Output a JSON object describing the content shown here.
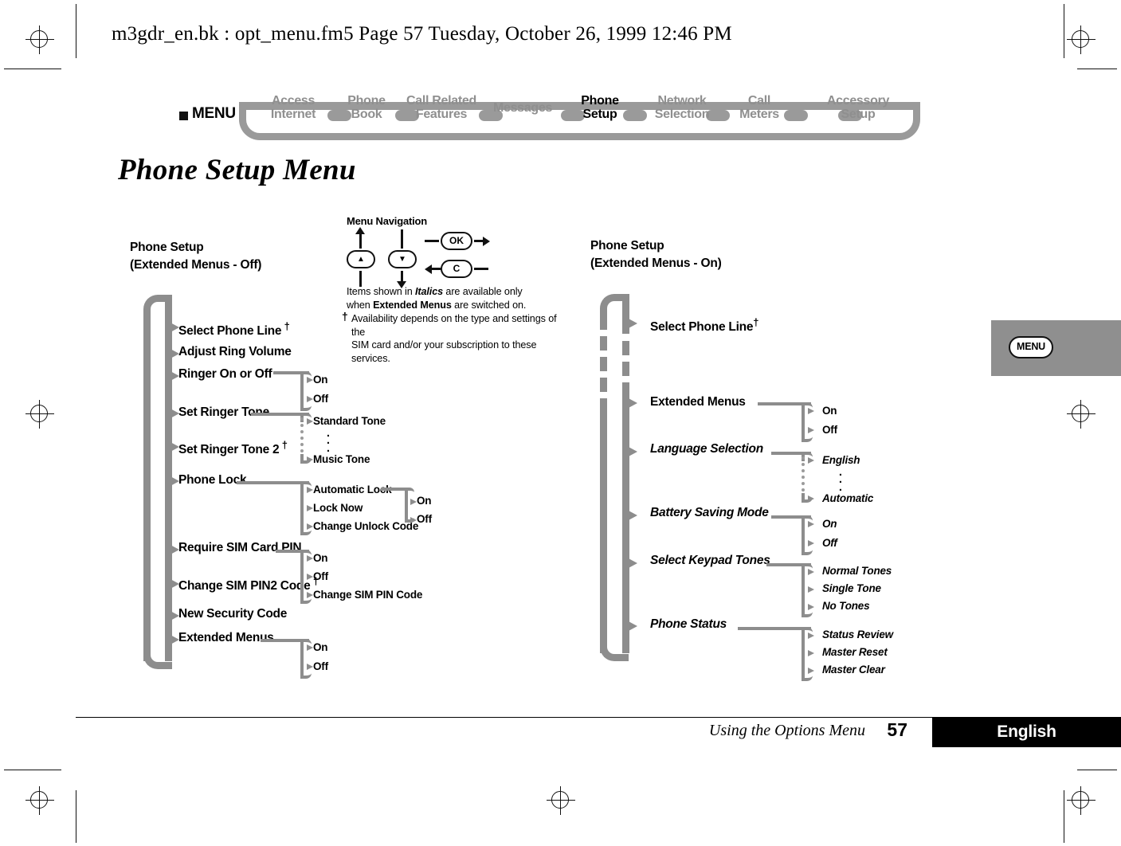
{
  "header": {
    "line": "m3gdr_en.bk : opt_menu.fm5  Page 57  Tuesday, October 26, 1999  12:46 PM"
  },
  "breadcrumb": {
    "root_label": "MENU",
    "items": [
      {
        "l1": "Access",
        "l2": "Internet",
        "current": false
      },
      {
        "l1": "Phone",
        "l2": "Book",
        "current": false
      },
      {
        "l1": "Call Related",
        "l2": "Features",
        "current": false
      },
      {
        "l1": "Messages",
        "l2": "",
        "current": false
      },
      {
        "l1": "Phone",
        "l2": "Setup",
        "current": true
      },
      {
        "l1": "Network",
        "l2": "Selection",
        "current": false
      },
      {
        "l1": "Call",
        "l2": "Meters",
        "current": false
      },
      {
        "l1": "Accessory",
        "l2": "Setup",
        "current": false
      }
    ]
  },
  "page_title": "Phone Setup Menu",
  "legend": {
    "title": "Menu Navigation",
    "keys": {
      "up": "▲",
      "down": "▼",
      "ok": "OK",
      "clear": "C"
    },
    "note_line1_a": "Items shown in ",
    "note_line1_i": "Italics",
    "note_line1_b": " are available only",
    "note_line2_a": "when ",
    "note_line2_b": "Extended Menus",
    "note_line2_c": " are switched on.",
    "dagger": "†",
    "note_line3": "Availability depends on the type and settings of the",
    "note_line4": "SIM card and/or your subscription to these services."
  },
  "diagram_left": {
    "title_line1": "Phone Setup",
    "title_line2": "(Extended Menus - Off)",
    "nodes": [
      {
        "label": "Select Phone Line",
        "dagger": true,
        "italic": false
      },
      {
        "label": "Adjust Ring Volume",
        "dagger": false,
        "italic": false
      },
      {
        "label": "Ringer On or Off",
        "dagger": false,
        "italic": false
      },
      {
        "label": "Set Ringer Tone",
        "dagger": false,
        "italic": false
      },
      {
        "label": "Set Ringer Tone 2",
        "dagger": true,
        "italic": false
      },
      {
        "label": "Phone Lock",
        "dagger": false,
        "italic": false
      },
      {
        "label": "Require SIM Card PIN",
        "dagger": false,
        "italic": false
      },
      {
        "label": "Change SIM PIN2 Code",
        "dagger": true,
        "italic": false
      },
      {
        "label": "New Security Code",
        "dagger": false,
        "italic": false
      },
      {
        "label": "Extended Menus",
        "dagger": false,
        "italic": false
      }
    ],
    "sub_ringer_onoff": [
      "On",
      "Off"
    ],
    "sub_ringer_tone": [
      "Standard Tone",
      "Music Tone"
    ],
    "sub_phone_lock": [
      "Automatic Lock",
      "Lock Now",
      "Change Unlock Code"
    ],
    "sub_automatic_lock": [
      "On",
      "Off"
    ],
    "sub_sim_pin": [
      "On",
      "Off",
      "Change SIM PIN Code"
    ],
    "sub_extended_menus": [
      "On",
      "Off"
    ]
  },
  "diagram_right": {
    "title_line1": "Phone Setup",
    "title_line2": "(Extended Menus - On)",
    "nodes": [
      {
        "label": "Select Phone Line",
        "dagger": true,
        "italic": false
      },
      {
        "label": "Extended Menus",
        "dagger": false,
        "italic": false
      },
      {
        "label": "Language Selection",
        "dagger": false,
        "italic": true
      },
      {
        "label": "Battery Saving Mode",
        "dagger": false,
        "italic": true
      },
      {
        "label": "Select Keypad Tones",
        "dagger": false,
        "italic": true
      },
      {
        "label": "Phone Status",
        "dagger": false,
        "italic": true
      }
    ],
    "sub_extended_menus": [
      "On",
      "Off"
    ],
    "sub_language": [
      "English",
      "Automatic"
    ],
    "sub_battery": [
      "On",
      "Off"
    ],
    "sub_keypad": [
      "Normal Tones",
      "Single Tone",
      "No Tones"
    ],
    "sub_status": [
      "Status Review",
      "Master Reset",
      "Master Clear"
    ]
  },
  "side_tab": {
    "label": "MENU"
  },
  "footer": {
    "chapter": "Using the Options Menu",
    "page_number": "57",
    "language": "English"
  },
  "colors": {
    "rule_gray": "#8d8d8d",
    "breadcrumb_gray": "#9a9a9a",
    "tab_gray": "#8f8f8f",
    "accent_black": "#000000"
  }
}
